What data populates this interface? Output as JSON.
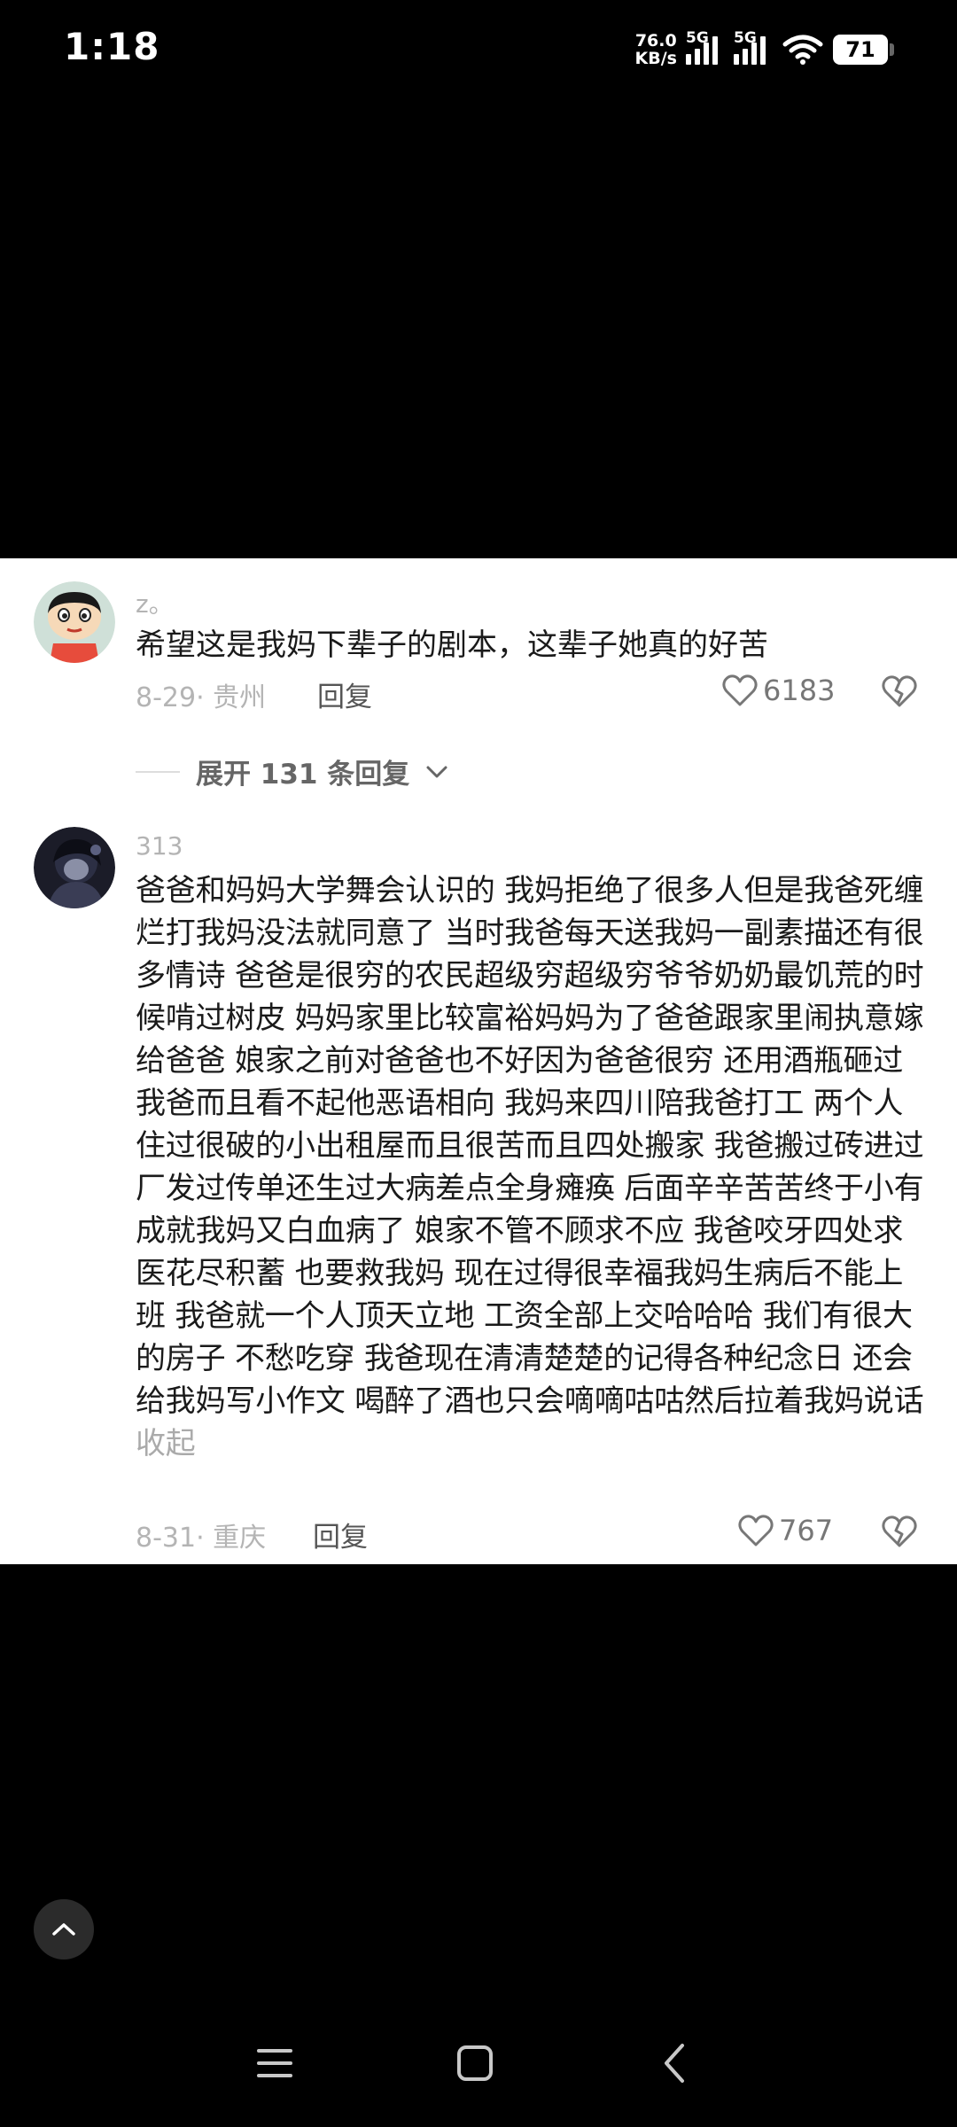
{
  "status_bar": {
    "time": "1:18",
    "net_speed_value": "76.0",
    "net_speed_unit": "KB/s",
    "sim1_tag": "5G",
    "sim2_tag": "5G",
    "battery": "71"
  },
  "comments": [
    {
      "username": "z。",
      "text": "希望这是我妈下辈子的剧本，这辈子她真的好苦",
      "date_location": "8-29· 贵州",
      "reply_label": "回复",
      "likes": "6183",
      "avatar_icon": "cartoon-boy-avatar"
    },
    {
      "username": "313",
      "text": "爸爸和妈妈大学舞会认识的 我妈拒绝了很多人但是我爸死缠烂打我妈没法就同意了 当时我爸每天送我妈一副素描还有很多情诗 爸爸是很穷的农民超级穷超级穷爷爷奶奶最饥荒的时候啃过树皮 妈妈家里比较富裕妈妈为了爸爸跟家里闹执意嫁给爸爸 娘家之前对爸爸也不好因为爸爸很穷 还用酒瓶砸过我爸而且看不起他恶语相向 我妈来四川陪我爸打工 两个人住过很破的小出租屋而且很苦而且四处搬家 我爸搬过砖进过厂发过传单还生过大病差点全身瘫痪 后面辛辛苦苦终于小有成就我妈又白血病了 娘家不管不顾求不应 我爸咬牙四处求医花尽积蓄 也要救我妈 现在过得很幸福我妈生病后不能上班 我爸就一个人顶天立地 工资全部上交哈哈哈 我们有很大的房子 不愁吃穿 我爸现在清清楚楚的记得各种纪念日 还会给我妈写小作文 喝醉了酒也只会嘀嘀咕咕然后拉着我妈说话",
      "collapse_label": "收起",
      "date_location": "8-31· 重庆",
      "reply_label": "回复",
      "likes": "767",
      "avatar_icon": "dark-anime-avatar"
    }
  ],
  "expand_replies": "展开 131 条回复",
  "icons": {
    "like": "heart-outline-icon",
    "dislike": "broken-heart-icon",
    "scroll_top": "chevron-up-icon",
    "nav_recents": "menu-icon",
    "nav_home": "square-icon",
    "nav_back": "chevron-left-icon"
  }
}
